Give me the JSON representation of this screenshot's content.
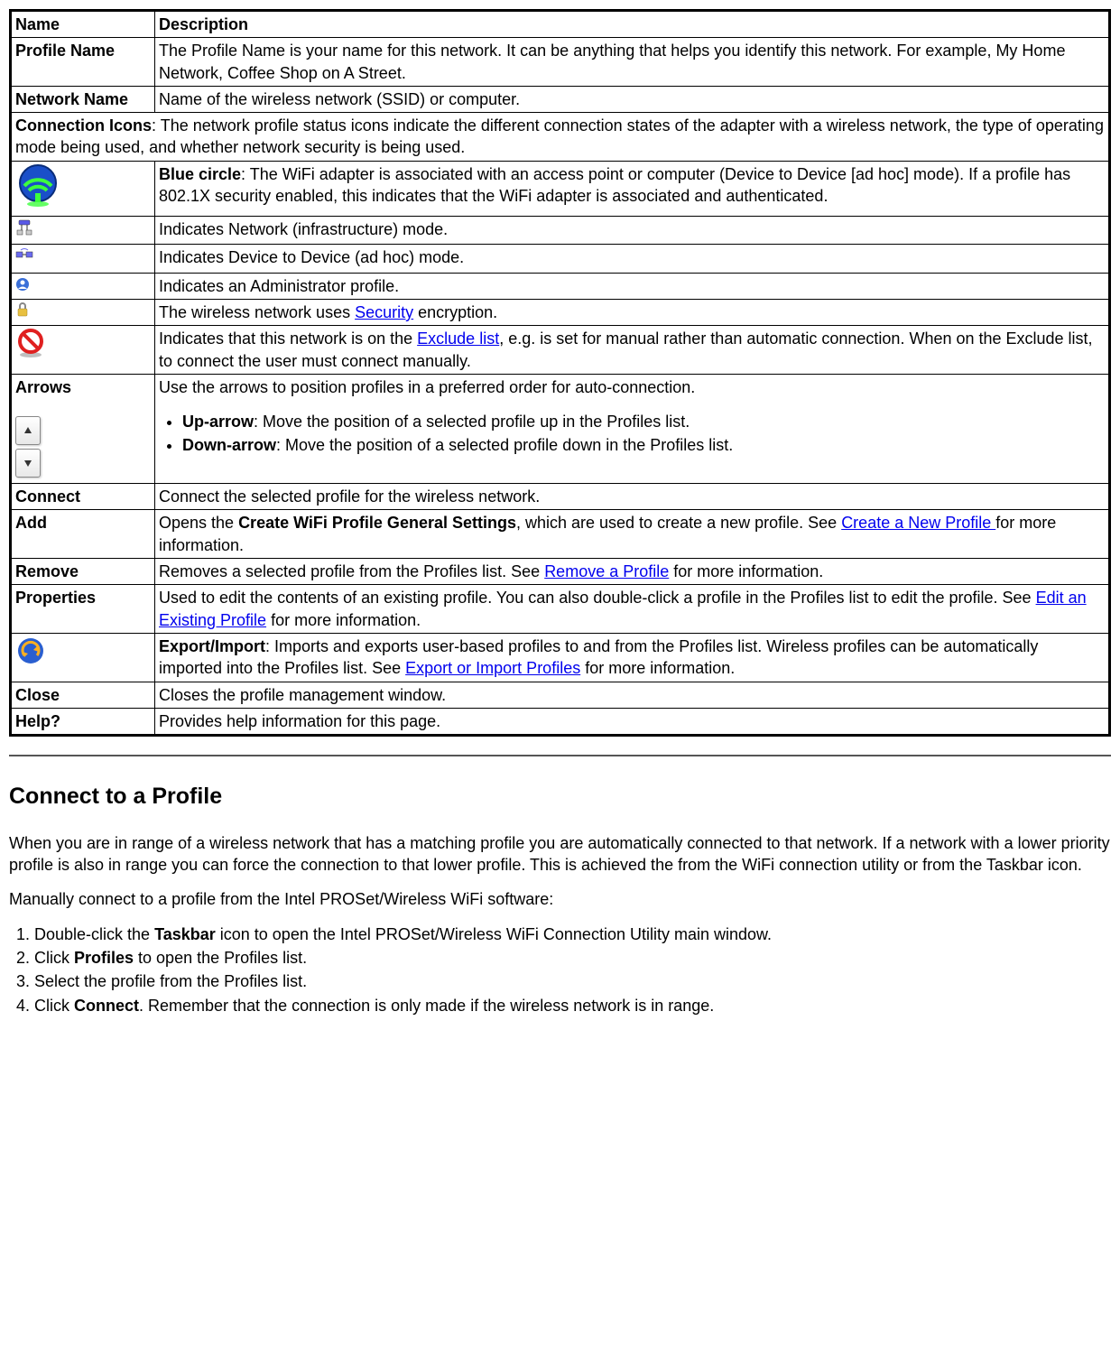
{
  "table": {
    "header_name": "Name",
    "header_desc": "Description",
    "profile_name_label": "Profile Name",
    "profile_name_desc": "The Profile Name is your name for this network. It can be anything that helps you identify this network. For example, My Home Network, Coffee Shop on A Street.",
    "network_name_label": "Network Name",
    "network_name_desc": "Name of the wireless network (SSID) or computer.",
    "connection_icons_lead": "Connection Icons",
    "connection_icons_rest": ": The network profile status icons indicate the different connection states of the adapter with a wireless network, the type of operating mode being used, and whether network security is being used.",
    "blue_circle_lead": "Blue circle",
    "blue_circle_rest": ": The WiFi adapter is associated with an access point or computer (Device to Device [ad hoc] mode). If a profile has 802.1X security enabled, this indicates that the WiFi adapter is associated and authenticated.",
    "infra_desc": "Indicates Network (infrastructure) mode.",
    "adhoc_desc": "Indicates Device to Device (ad hoc) mode.",
    "admin_desc": "Indicates an Administrator profile.",
    "security_desc_pre": "The wireless network uses ",
    "security_link": "Security",
    "security_desc_post": " encryption.",
    "exclude_pre": "Indicates that this network is on the ",
    "exclude_link": "Exclude list",
    "exclude_post": ", e.g. is set for manual rather than automatic connection. When on the Exclude list, to connect the user must connect manually.",
    "arrows_label": "Arrows",
    "arrows_intro": "Use the arrows to position profiles in a preferred order for auto-connection.",
    "up_arrow_lead": "Up-arrow",
    "up_arrow_rest": ": Move the position of a selected profile up in the Profiles list.",
    "down_arrow_lead": "Down-arrow",
    "down_arrow_rest": ": Move the position of a selected profile down in the Profiles list.",
    "connect_label": "Connect",
    "connect_desc": "Connect the selected profile for the wireless network.",
    "add_label": "Add",
    "add_pre": "Opens the ",
    "add_bold": "Create WiFi Profile General Settings",
    "add_mid": ", which are used to create a new profile. See ",
    "add_link": "Create a New Profile ",
    "add_post": "for more information.",
    "remove_label": "Remove",
    "remove_pre": "Removes a selected profile from the Profiles list. See ",
    "remove_link": "Remove a Profile",
    "remove_post": " for more information.",
    "properties_label": "Properties",
    "properties_pre": "Used to edit the contents of an existing profile. You can also double-click a profile in the Profiles list to edit the profile. See ",
    "properties_link": "Edit an Existing Profile",
    "properties_post": " for more information.",
    "export_lead": "Export/Import",
    "export_pre": ": Imports and exports user-based profiles to and from the Profiles list. Wireless profiles can be automatically imported into the Profiles list. See ",
    "export_link": "Export or Import Profiles",
    "export_post": " for more information.",
    "close_label": "Close",
    "close_desc": "Closes the profile management window.",
    "help_label": "Help?",
    "help_desc": "Provides help information for this page."
  },
  "section": {
    "heading": "Connect to a Profile",
    "para1": "When you are in range of a wireless network that has a matching profile you are automatically connected to that network. If a network with a lower priority profile is also in range you can force the connection to that lower profile. This is achieved the from the WiFi connection utility or from the Taskbar icon.",
    "para2": "Manually connect to a profile from the Intel PROSet/Wireless WiFi software:",
    "step1_pre": "Double-click the ",
    "step1_bold": "Taskbar",
    "step1_post": " icon to open the Intel PROSet/Wireless WiFi Connection Utility main window.",
    "step2_pre": "Click ",
    "step2_bold": "Profiles",
    "step2_post": " to open the Profiles list.",
    "step3": "Select the profile from the Profiles list.",
    "step4_pre": "Click ",
    "step4_bold": "Connect",
    "step4_post": ". Remember that the connection is only made if the wireless network is in range."
  }
}
